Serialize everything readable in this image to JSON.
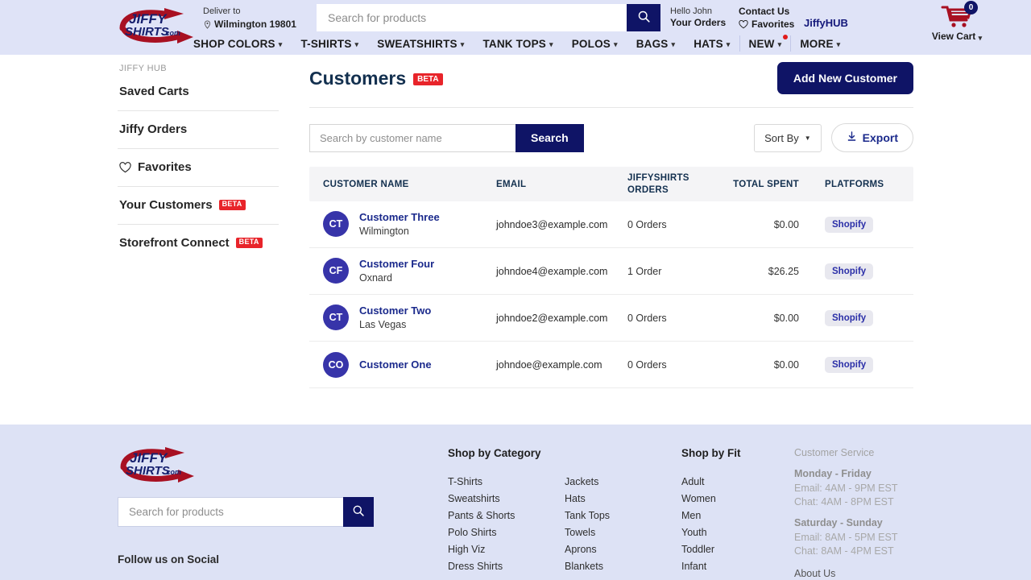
{
  "header": {
    "logo_alt": "JiffyShirts.com",
    "deliver_label": "Deliver to",
    "deliver_value": "Wilmington 19801",
    "search_placeholder": "Search for products",
    "account_greeting": "Hello John",
    "account_orders": "Your Orders",
    "contact_us": "Contact Us",
    "favorites": "Favorites",
    "jiffyhub": "JiffyHUB",
    "cart_label": "View Cart",
    "cart_count": "0",
    "nav": [
      {
        "label": "SHOP COLORS",
        "caret": true,
        "dot": false
      },
      {
        "label": "T-SHIRTS",
        "caret": true,
        "dot": false
      },
      {
        "label": "SWEATSHIRTS",
        "caret": true,
        "dot": false
      },
      {
        "label": "TANK TOPS",
        "caret": true,
        "dot": false
      },
      {
        "label": "POLOS",
        "caret": true,
        "dot": false
      },
      {
        "label": "BAGS",
        "caret": true,
        "dot": false
      },
      {
        "label": "HATS",
        "caret": true,
        "dot": false
      },
      {
        "label": "NEW",
        "caret": true,
        "dot": true
      },
      {
        "label": "MORE",
        "caret": true,
        "dot": false
      }
    ]
  },
  "sidebar": {
    "eyebrow": "JIFFY HUB",
    "items": [
      {
        "label": "Saved Carts",
        "icon": null,
        "beta": null
      },
      {
        "label": "Jiffy Orders",
        "icon": null,
        "beta": null
      },
      {
        "label": "Favorites",
        "icon": "heart-icon",
        "beta": null
      },
      {
        "label": "Your Customers",
        "icon": null,
        "beta": "BETA"
      },
      {
        "label": "Storefront Connect",
        "icon": null,
        "beta": "BETA"
      }
    ]
  },
  "main": {
    "title": "Customers",
    "title_badge": "BETA",
    "add_button": "Add New Customer",
    "search_placeholder": "Search by customer name",
    "search_button": "Search",
    "sort_by": "Sort By",
    "export": "Export",
    "columns": {
      "name": "CUSTOMER NAME",
      "email": "EMAIL",
      "orders_line1": "JIFFYSHIRTS",
      "orders_line2": "ORDERS",
      "spent": "TOTAL SPENT",
      "platforms": "PLATFORMS"
    },
    "rows": [
      {
        "initials": "CT",
        "name": "Customer Three",
        "city": "Wilmington",
        "email": "johndoe3@example.com",
        "orders": "0 Orders",
        "spent": "$0.00",
        "platform": "Shopify"
      },
      {
        "initials": "CF",
        "name": "Customer Four",
        "city": "Oxnard",
        "email": "johndoe4@example.com",
        "orders": "1 Order",
        "spent": "$26.25",
        "platform": "Shopify"
      },
      {
        "initials": "CT",
        "name": "Customer Two",
        "city": "Las Vegas",
        "email": "johndoe2@example.com",
        "orders": "0 Orders",
        "spent": "$0.00",
        "platform": "Shopify"
      },
      {
        "initials": "CO",
        "name": "Customer One",
        "city": "",
        "email": "johndoe@example.com",
        "orders": "0 Orders",
        "spent": "$0.00",
        "platform": "Shopify"
      }
    ]
  },
  "footer": {
    "search_placeholder": "Search for products",
    "social_title": "Follow us on Social",
    "category_title": "Shop by Category",
    "category_col1": [
      "T-Shirts",
      "Sweatshirts",
      "Pants & Shorts",
      "Polo Shirts",
      "High Viz",
      "Dress Shirts"
    ],
    "category_col2": [
      "Jackets",
      "Hats",
      "Tank Tops",
      "Towels",
      "Aprons",
      "Blankets"
    ],
    "fit_title": "Shop by Fit",
    "fit_items": [
      "Adult",
      "Women",
      "Men",
      "Youth",
      "Toddler",
      "Infant"
    ],
    "cs_title": "Customer Service",
    "cs_blocks": [
      {
        "day": "Monday - Friday",
        "lines": [
          "Email: 4AM - 9PM EST",
          "Chat: 4AM - 8PM EST"
        ]
      },
      {
        "day": "Saturday - Sunday",
        "lines": [
          "Email: 8AM - 5PM EST",
          "Chat: 8AM - 4PM EST"
        ]
      }
    ],
    "about": "About Us"
  },
  "colors": {
    "navy": "#0f1466",
    "header_bg": "#dfe3f7",
    "footer_bg": "#dde2f5",
    "beta_red": "#e8242a",
    "avatar": "#3734a9",
    "logo_red": "#a81022",
    "link_indigo": "#1b2a8c"
  }
}
